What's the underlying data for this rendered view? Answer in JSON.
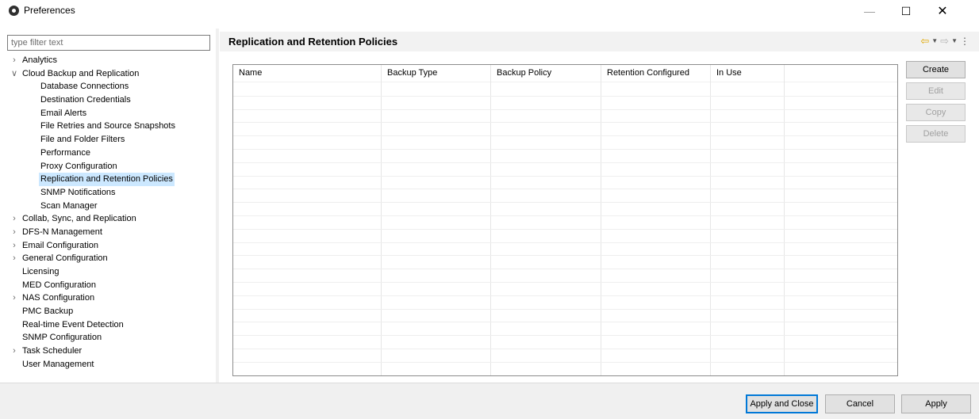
{
  "window": {
    "title": "Preferences",
    "icon": "app-gear-icon",
    "controls": {
      "minimize": "—",
      "maximize": "☐",
      "close": "✕"
    }
  },
  "filter": {
    "placeholder": "type filter text",
    "value": ""
  },
  "tree": [
    {
      "label": "Analytics",
      "level": 0,
      "expander": "collapsed"
    },
    {
      "label": "Cloud Backup and Replication",
      "level": 0,
      "expander": "expanded"
    },
    {
      "label": "Database Connections",
      "level": 1
    },
    {
      "label": "Destination Credentials",
      "level": 1
    },
    {
      "label": "Email Alerts",
      "level": 1
    },
    {
      "label": "File Retries and Source Snapshots",
      "level": 1
    },
    {
      "label": "File and Folder Filters",
      "level": 1
    },
    {
      "label": "Performance",
      "level": 1
    },
    {
      "label": "Proxy Configuration",
      "level": 1
    },
    {
      "label": "Replication and Retention Policies",
      "level": 1,
      "selected": true
    },
    {
      "label": "SNMP Notifications",
      "level": 1
    },
    {
      "label": "Scan Manager",
      "level": 1
    },
    {
      "label": "Collab, Sync, and Replication",
      "level": 0,
      "expander": "collapsed"
    },
    {
      "label": "DFS-N Management",
      "level": 0,
      "expander": "collapsed"
    },
    {
      "label": "Email Configuration",
      "level": 0,
      "expander": "collapsed"
    },
    {
      "label": "General Configuration",
      "level": 0,
      "expander": "collapsed"
    },
    {
      "label": "Licensing",
      "level": 0
    },
    {
      "label": "MED Configuration",
      "level": 0
    },
    {
      "label": "NAS Configuration",
      "level": 0,
      "expander": "collapsed"
    },
    {
      "label": "PMC Backup",
      "level": 0
    },
    {
      "label": "Real-time Event Detection",
      "level": 0
    },
    {
      "label": "SNMP Configuration",
      "level": 0
    },
    {
      "label": "Task Scheduler",
      "level": 0,
      "expander": "collapsed"
    },
    {
      "label": "User Management",
      "level": 0
    }
  ],
  "page": {
    "title": "Replication and Retention Policies",
    "nav_icons": [
      "back-arrow-icon",
      "dropdown-icon",
      "forward-arrow-icon",
      "dropdown-icon",
      "view-menu-icon"
    ]
  },
  "table": {
    "columns": [
      "Name",
      "Backup Type",
      "Backup Policy",
      "Retention Configured",
      "In Use",
      ""
    ],
    "rows": []
  },
  "side_buttons": {
    "create": "Create",
    "edit": "Edit",
    "copy": "Copy",
    "delete": "Delete"
  },
  "footer": {
    "apply_close": "Apply and Close",
    "cancel": "Cancel",
    "apply": "Apply"
  },
  "colors": {
    "selection": "#cce8ff",
    "primary_border": "#0078d7",
    "back_arrow": "#e0a800"
  }
}
